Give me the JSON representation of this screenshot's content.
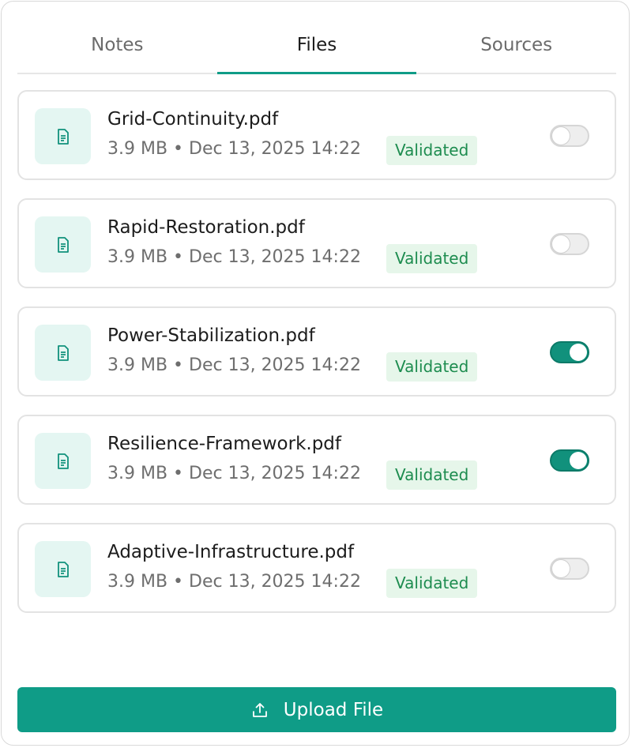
{
  "tabs": [
    {
      "label": "Notes",
      "active": false
    },
    {
      "label": "Files",
      "active": true
    },
    {
      "label": "Sources",
      "active": false
    }
  ],
  "files": [
    {
      "name": "Grid-Continuity.pdf",
      "meta": "3.9 MB • Dec 13, 2025 14:22",
      "status": "Validated",
      "enabled": false
    },
    {
      "name": "Rapid-Restoration.pdf",
      "meta": "3.9 MB • Dec 13, 2025 14:22",
      "status": "Validated",
      "enabled": false
    },
    {
      "name": "Power-Stabilization.pdf",
      "meta": "3.9 MB • Dec 13, 2025 14:22",
      "status": "Validated",
      "enabled": true
    },
    {
      "name": "Resilience-Framework.pdf",
      "meta": "3.9 MB • Dec 13, 2025 14:22",
      "status": "Validated",
      "enabled": true
    },
    {
      "name": "Adaptive-Infrastructure.pdf",
      "meta": "3.9 MB • Dec 13, 2025 14:22",
      "status": "Validated",
      "enabled": false
    }
  ],
  "upload": {
    "label": "Upload File",
    "icon": "upload-icon"
  },
  "icons": {
    "file": "document-icon"
  },
  "colors": {
    "accent": "#0f9c87",
    "badge_bg": "#e6f6ea",
    "badge_text": "#1d8c4f",
    "icon_bg": "#e4f6f2"
  }
}
